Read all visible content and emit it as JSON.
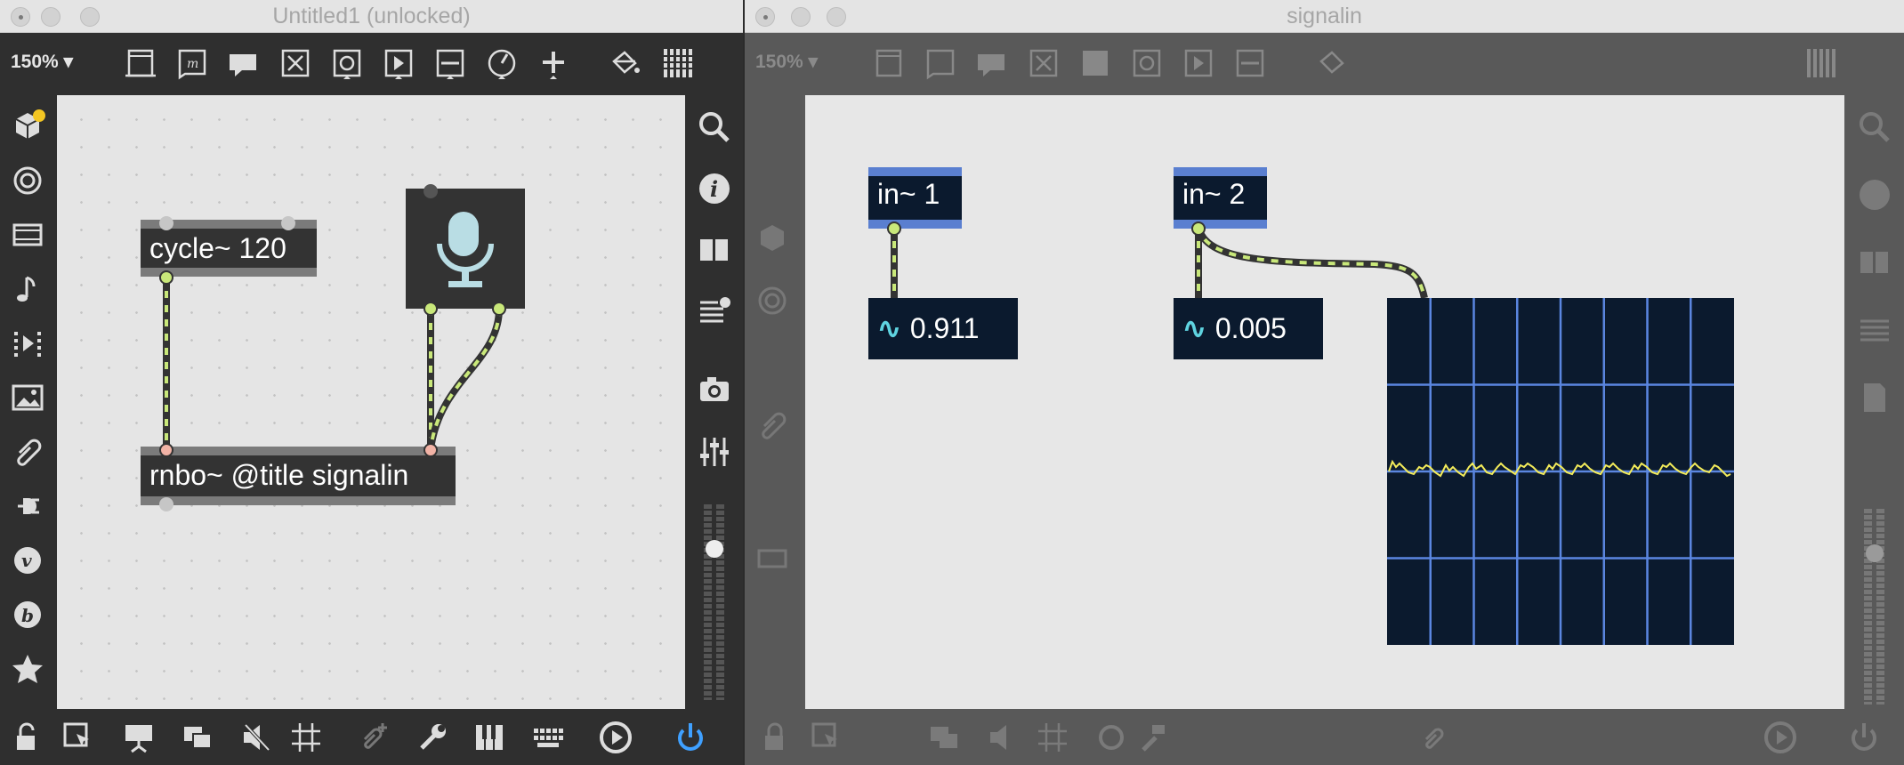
{
  "window1": {
    "title": "Untitled1 (unlocked)",
    "zoom_label": "150% ▾",
    "toolbar_icons": [
      "presentation-frame-icon",
      "message-box-icon",
      "comment-icon",
      "toggle-x-icon",
      "bang-icon",
      "play-button-icon",
      "slider-icon",
      "dial-icon",
      "plus-icon",
      "paint-bucket-icon",
      "grid-icon"
    ],
    "left_sidebar_icons": [
      "package-cube-icon",
      "target-icon",
      "film-icon",
      "music-note-icon",
      "video-frames-icon",
      "image-icon",
      "paperclip-icon",
      "plug-icon",
      "v-icon",
      "b-icon",
      "star-icon"
    ],
    "right_sidebar_icons": [
      "search-icon",
      "info-icon",
      "book-icon",
      "list-icon",
      "camera-icon",
      "mixer-sliders-icon"
    ],
    "objects": {
      "cycle": "cycle~ 120",
      "rnbo": "rnbo~ @title signalin"
    },
    "bottom_icons": [
      "lock-icon",
      "cursor-icon",
      "presentation-icon",
      "windows-icon",
      "mute-icon",
      "grid-icon",
      "clip-add-icon",
      "wrench-icon",
      "piano-icon",
      "keyboard-icon",
      "play-circle-icon",
      "power-icon"
    ]
  },
  "window2": {
    "title": "signalin",
    "zoom_label": "150% ▾",
    "objects": {
      "in1": "in~ 1",
      "in2": "in~ 2",
      "num1": "0.911",
      "num2": "0.005"
    }
  },
  "colors": {
    "accent_blue": "#5a7fd0",
    "patch_cord": "#c9e87a",
    "scope_bg": "#0b1a2e",
    "scope_grid": "#5b86e0",
    "scope_trace": "#f4ec5a",
    "badge_yellow": "#f3c623",
    "power_blue": "#3fa0ff"
  }
}
